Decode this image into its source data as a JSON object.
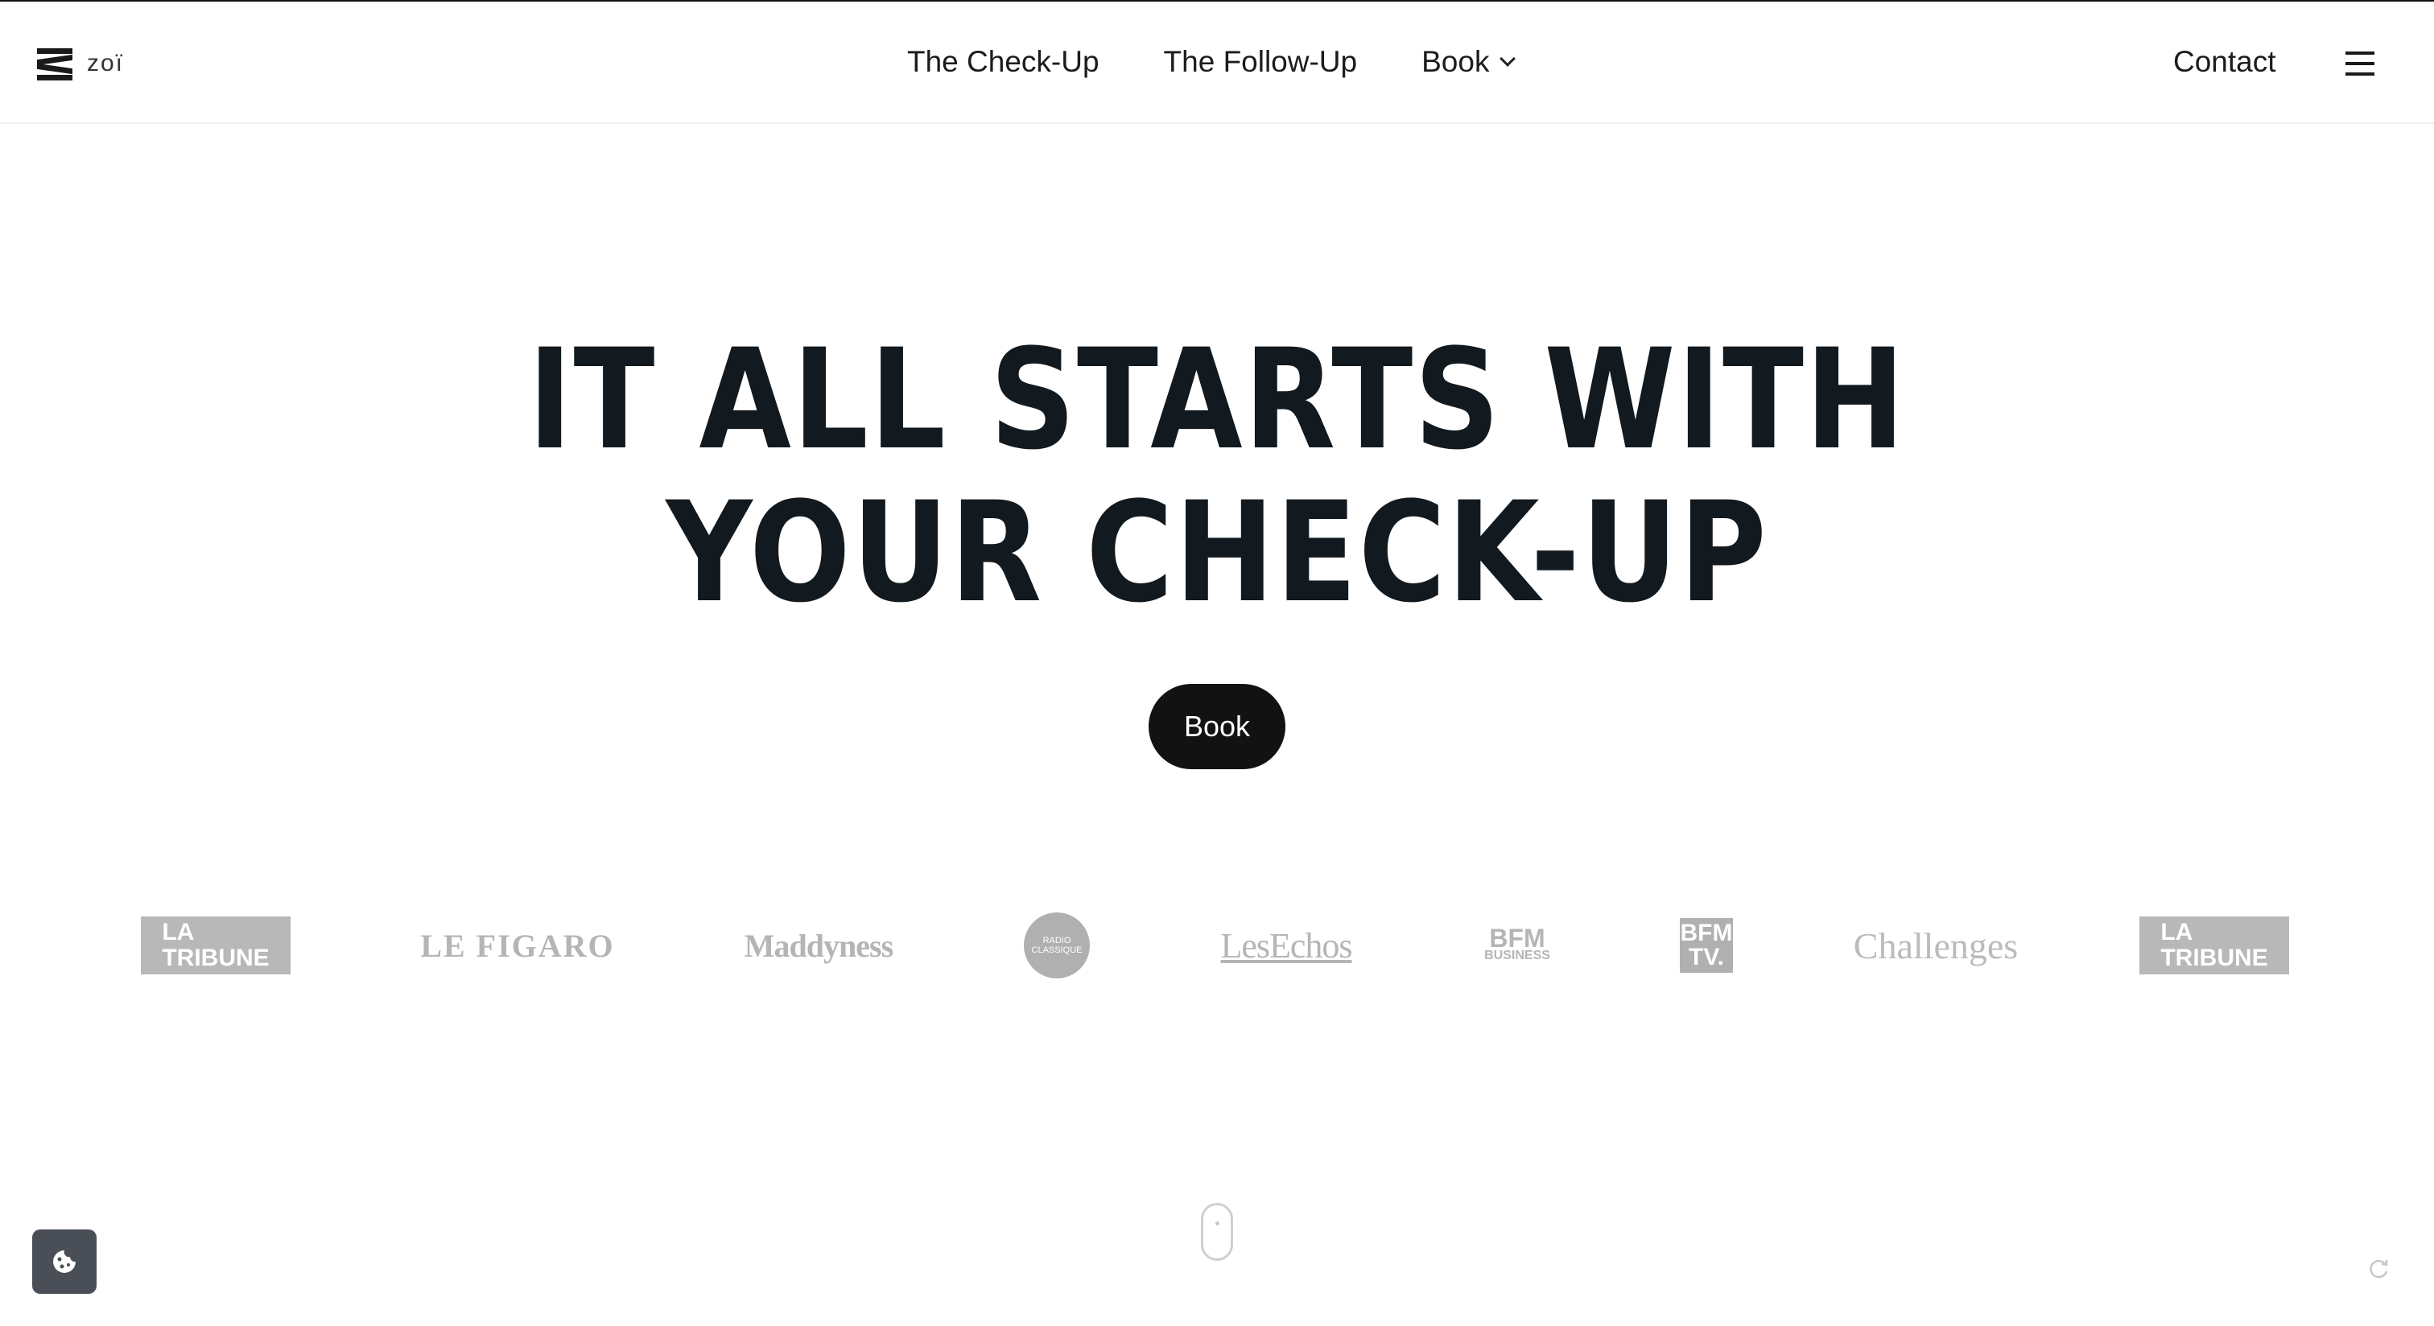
{
  "header": {
    "logo_text": "zoï",
    "nav": [
      {
        "label": "The Check-Up"
      },
      {
        "label": "The Follow-Up"
      },
      {
        "label": "Book"
      }
    ],
    "contact_label": "Contact"
  },
  "hero": {
    "title_line1": "IT ALL STARTS WITH",
    "title_line2": "YOUR CHECK-UP",
    "cta_label": "Book"
  },
  "press": {
    "logos": [
      {
        "name": "La Tribune",
        "text_line1": "LA",
        "text_line2": "TRIBUNE"
      },
      {
        "name": "Le Figaro",
        "text": "LE FIGARO"
      },
      {
        "name": "Maddyness",
        "text": "Maddyness"
      },
      {
        "name": "Radio Classique",
        "text_line1": "RADIO",
        "text_line2": "CLASSIQUE"
      },
      {
        "name": "Les Echos",
        "text": "LesEchos"
      },
      {
        "name": "BFM Business",
        "text_line1": "BFM",
        "text_line2": "BUSINESS"
      },
      {
        "name": "BFM TV",
        "text_line1": "BFM",
        "text_line2": "TV."
      },
      {
        "name": "Challenges",
        "text": "Challenges"
      },
      {
        "name": "La Tribune",
        "text_line1": "LA",
        "text_line2": "TRIBUNE"
      }
    ]
  },
  "colors": {
    "text": "#121a1f",
    "button_bg": "#121212",
    "logo_gray": "#b5b5b5",
    "cookie_bg": "#4a4f57"
  },
  "icons": [
    "zoi-logo-icon",
    "chevron-down-icon",
    "hamburger-menu-icon",
    "scroll-mouse-icon",
    "cookie-icon",
    "refresh-icon"
  ]
}
